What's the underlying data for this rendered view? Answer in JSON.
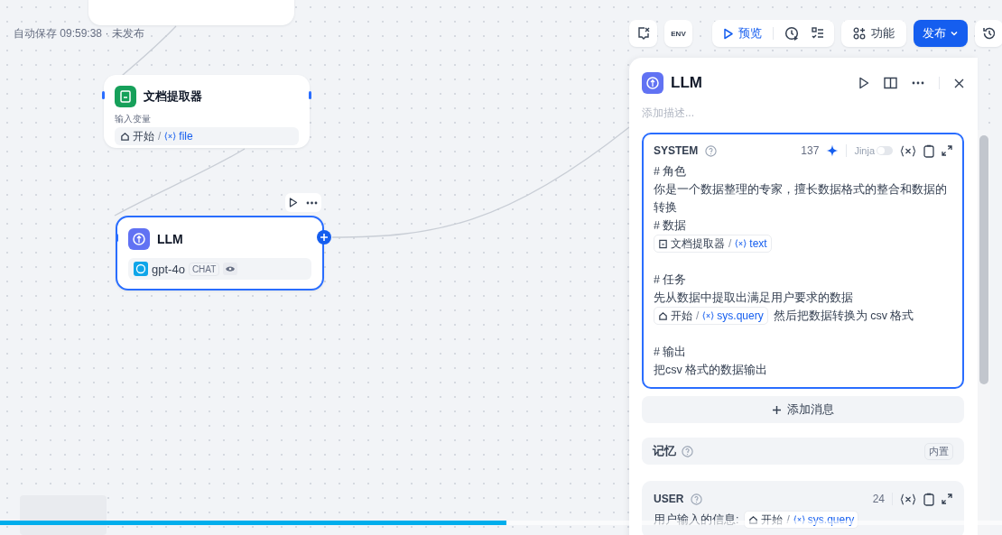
{
  "autosave": "自动保存 09:59:38 · 未发布",
  "toolbar": {
    "env": "ENV",
    "preview": "预览",
    "features": "功能",
    "publish": "发布"
  },
  "doc_node": {
    "title": "文档提取器",
    "input_label": "输入变量",
    "var": {
      "kind": "startvar",
      "node": "开始",
      "separator": "/",
      "name": "file"
    }
  },
  "llm_node": {
    "title": "LLM",
    "model": "gpt-4o",
    "mode": "CHAT",
    "selected": true
  },
  "panel": {
    "title": "LLM",
    "description_placeholder": "添加描述...",
    "system": {
      "role": "SYSTEM",
      "count": "137",
      "jinja_label": "Jinja",
      "jinja_on": false,
      "focused": true,
      "lines": [
        {
          "kind": "text",
          "segments": [
            {
              "kind": "text",
              "text": "# 角色"
            }
          ]
        },
        {
          "kind": "text",
          "segments": [
            {
              "kind": "text",
              "text": "你是一个数据整理的专家，擅长数据格式的整合和数据的转换"
            }
          ]
        },
        {
          "kind": "text",
          "segments": [
            {
              "kind": "text",
              "text": "# 数据"
            }
          ]
        },
        {
          "kind": "text",
          "segments": [
            {
              "kind": "docvar",
              "node": "文档提取器",
              "separator": "/",
              "name": "text"
            }
          ]
        },
        {
          "kind": "blank"
        },
        {
          "kind": "text",
          "segments": [
            {
              "kind": "text",
              "text": "# 任务"
            }
          ]
        },
        {
          "kind": "text",
          "segments": [
            {
              "kind": "text",
              "text": "先从数据中提取出满足用户要求的数据"
            }
          ]
        },
        {
          "kind": "text",
          "segments": [
            {
              "kind": "startvar",
              "node": "开始",
              "separator": "/",
              "name": "sys.query"
            },
            {
              "kind": "text",
              "text": "然后把数据转换为 csv 格式"
            }
          ]
        },
        {
          "kind": "blank"
        },
        {
          "kind": "text",
          "segments": [
            {
              "kind": "text",
              "text": "# 输出"
            }
          ]
        },
        {
          "kind": "text",
          "segments": [
            {
              "kind": "text",
              "text": "把csv 格式的数据输出"
            }
          ]
        }
      ]
    },
    "add_message": "添加消息",
    "memory": {
      "label": "记忆",
      "badge": "内置"
    },
    "user": {
      "role": "USER",
      "count": "24",
      "focused": false,
      "lines": [
        {
          "kind": "text",
          "segments": [
            {
              "kind": "text",
              "text": "用户输入的信息:"
            },
            {
              "kind": "startvar",
              "node": "开始",
              "separator": "/",
              "name": "sys.query"
            }
          ]
        }
      ]
    }
  },
  "video_progress": {
    "level": 0.505
  }
}
